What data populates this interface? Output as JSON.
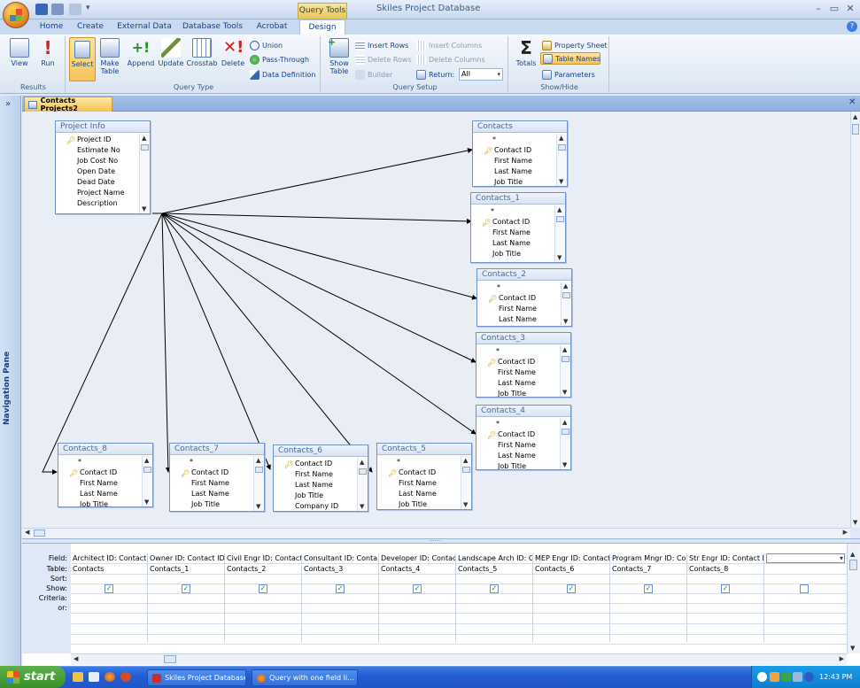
{
  "window": {
    "title": "Skiles Project Database",
    "contextual_tab_group": "Query Tools",
    "controls": {
      "minimize": "–",
      "restore": "▭",
      "close": "✕"
    }
  },
  "ribbon_tabs": [
    "Home",
    "Create",
    "External Data",
    "Database Tools",
    "Acrobat",
    "Design"
  ],
  "ribbon": {
    "results": {
      "label": "Results",
      "view": "View",
      "run": "Run"
    },
    "query_type": {
      "label": "Query Type",
      "select": "Select",
      "make_table": "Make Table",
      "append": "Append",
      "update": "Update",
      "crosstab": "Crosstab",
      "delete": "Delete",
      "union": "Union",
      "pass_through": "Pass-Through",
      "data_definition": "Data Definition"
    },
    "query_setup": {
      "label": "Query Setup",
      "show_table": "Show Table",
      "insert_rows": "Insert Rows",
      "delete_rows": "Delete Rows",
      "builder": "Builder",
      "insert_columns": "Insert Columns",
      "delete_columns": "Delete Columns",
      "return_label": "Return:",
      "return_value": "All"
    },
    "show_hide": {
      "label": "Show/Hide",
      "totals": "Totals",
      "property_sheet": "Property Sheet",
      "table_names": "Table Names",
      "parameters": "Parameters"
    }
  },
  "nav_pane": {
    "label": "Navigation Pane",
    "toggle": "»"
  },
  "document": {
    "tab_title": "Contacts Projects2",
    "close": "✕"
  },
  "tables": {
    "project_info": {
      "title": "Project Info",
      "fields": [
        "Project ID",
        "Estimate No",
        "Job Cost No",
        "Open Date",
        "Dead Date",
        "Project Name",
        "Description"
      ]
    },
    "contacts": {
      "title": "Contacts",
      "fields": [
        "*",
        "Contact ID",
        "First Name",
        "Last Name",
        "Job Title"
      ]
    },
    "contacts_1": {
      "title": "Contacts_1",
      "fields": [
        "*",
        "Contact ID",
        "First Name",
        "Last Name",
        "Job Title"
      ]
    },
    "contacts_2": {
      "title": "Contacts_2",
      "fields": [
        "*",
        "Contact ID",
        "First Name",
        "Last Name"
      ]
    },
    "contacts_3": {
      "title": "Contacts_3",
      "fields": [
        "*",
        "Contact ID",
        "First Name",
        "Last Name",
        "Job Title"
      ]
    },
    "contacts_4": {
      "title": "Contacts_4",
      "fields": [
        "*",
        "Contact ID",
        "First Name",
        "Last Name",
        "Job Title"
      ]
    },
    "contacts_5": {
      "title": "Contacts_5",
      "fields": [
        "*",
        "Contact ID",
        "First Name",
        "Last Name",
        "Job Title"
      ]
    },
    "contacts_6": {
      "title": "Contacts_6",
      "fields": [
        "Contact ID",
        "First Name",
        "Last Name",
        "Job Title",
        "Company ID"
      ]
    },
    "contacts_7": {
      "title": "Contacts_7",
      "fields": [
        "*",
        "Contact ID",
        "First Name",
        "Last Name",
        "Job Title"
      ]
    },
    "contacts_8": {
      "title": "Contacts_8",
      "fields": [
        "*",
        "Contact ID",
        "First Name",
        "Last Name",
        "Job Title"
      ]
    }
  },
  "grid": {
    "row_labels": [
      "Field:",
      "Table:",
      "Sort:",
      "Show:",
      "Criteria:",
      "or:"
    ],
    "columns": [
      {
        "field": "Architect ID: Contact I",
        "table": "Contacts",
        "show": true
      },
      {
        "field": "Owner ID: Contact ID",
        "table": "Contacts_1",
        "show": true
      },
      {
        "field": "Civil Engr ID: Contact",
        "table": "Contacts_2",
        "show": true
      },
      {
        "field": "Consultant ID: Conta",
        "table": "Contacts_3",
        "show": true
      },
      {
        "field": "Developer ID: Contact",
        "table": "Contacts_4",
        "show": true
      },
      {
        "field": "Landscape Arch ID: Co",
        "table": "Contacts_5",
        "show": true
      },
      {
        "field": "MEP Engr ID: Contact",
        "table": "Contacts_6",
        "show": true
      },
      {
        "field": "Program Mngr ID: Co",
        "table": "Contacts_7",
        "show": true
      },
      {
        "field": "Str Engr ID: Contact II",
        "table": "Contacts_8",
        "show": true
      },
      {
        "field": "",
        "table": "",
        "show": false
      }
    ]
  },
  "taskbar": {
    "start": "start",
    "buttons": [
      "Skiles Project Database",
      "Query with one field li..."
    ],
    "clock": "12:43 PM"
  }
}
